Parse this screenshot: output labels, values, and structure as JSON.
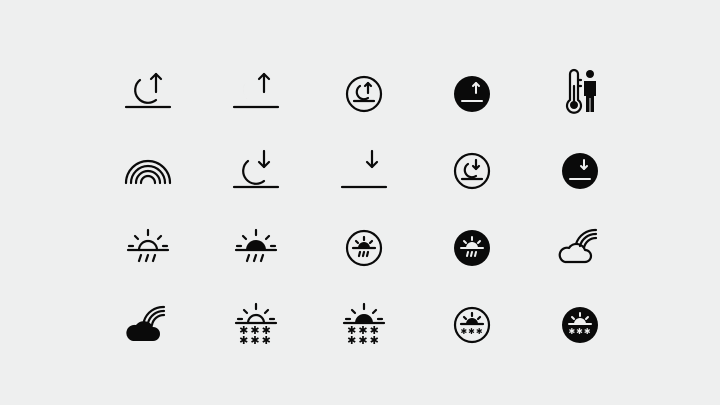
{
  "icons": [
    {
      "name": "moonrise-icon"
    },
    {
      "name": "moonrise-fill-icon"
    },
    {
      "name": "moonrise-circle-icon"
    },
    {
      "name": "moonrise-circle-fill-icon"
    },
    {
      "name": "thermometer-person-icon"
    },
    {
      "name": "rainbow-icon"
    },
    {
      "name": "moonset-icon"
    },
    {
      "name": "moonset-fill-icon"
    },
    {
      "name": "moonset-circle-icon"
    },
    {
      "name": "moonset-circle-fill-icon"
    },
    {
      "name": "sun-horizon-rain-icon"
    },
    {
      "name": "sun-horizon-rain-fill-icon"
    },
    {
      "name": "sun-horizon-rain-circle-icon"
    },
    {
      "name": "sun-horizon-rain-circle-fill-icon"
    },
    {
      "name": "cloud-rainbow-icon"
    },
    {
      "name": "cloud-rainbow-fill-icon"
    },
    {
      "name": "sun-snow-icon"
    },
    {
      "name": "sun-snow-fill-icon"
    },
    {
      "name": "sun-snow-circle-icon"
    },
    {
      "name": "sun-snow-circle-fill-icon"
    }
  ]
}
